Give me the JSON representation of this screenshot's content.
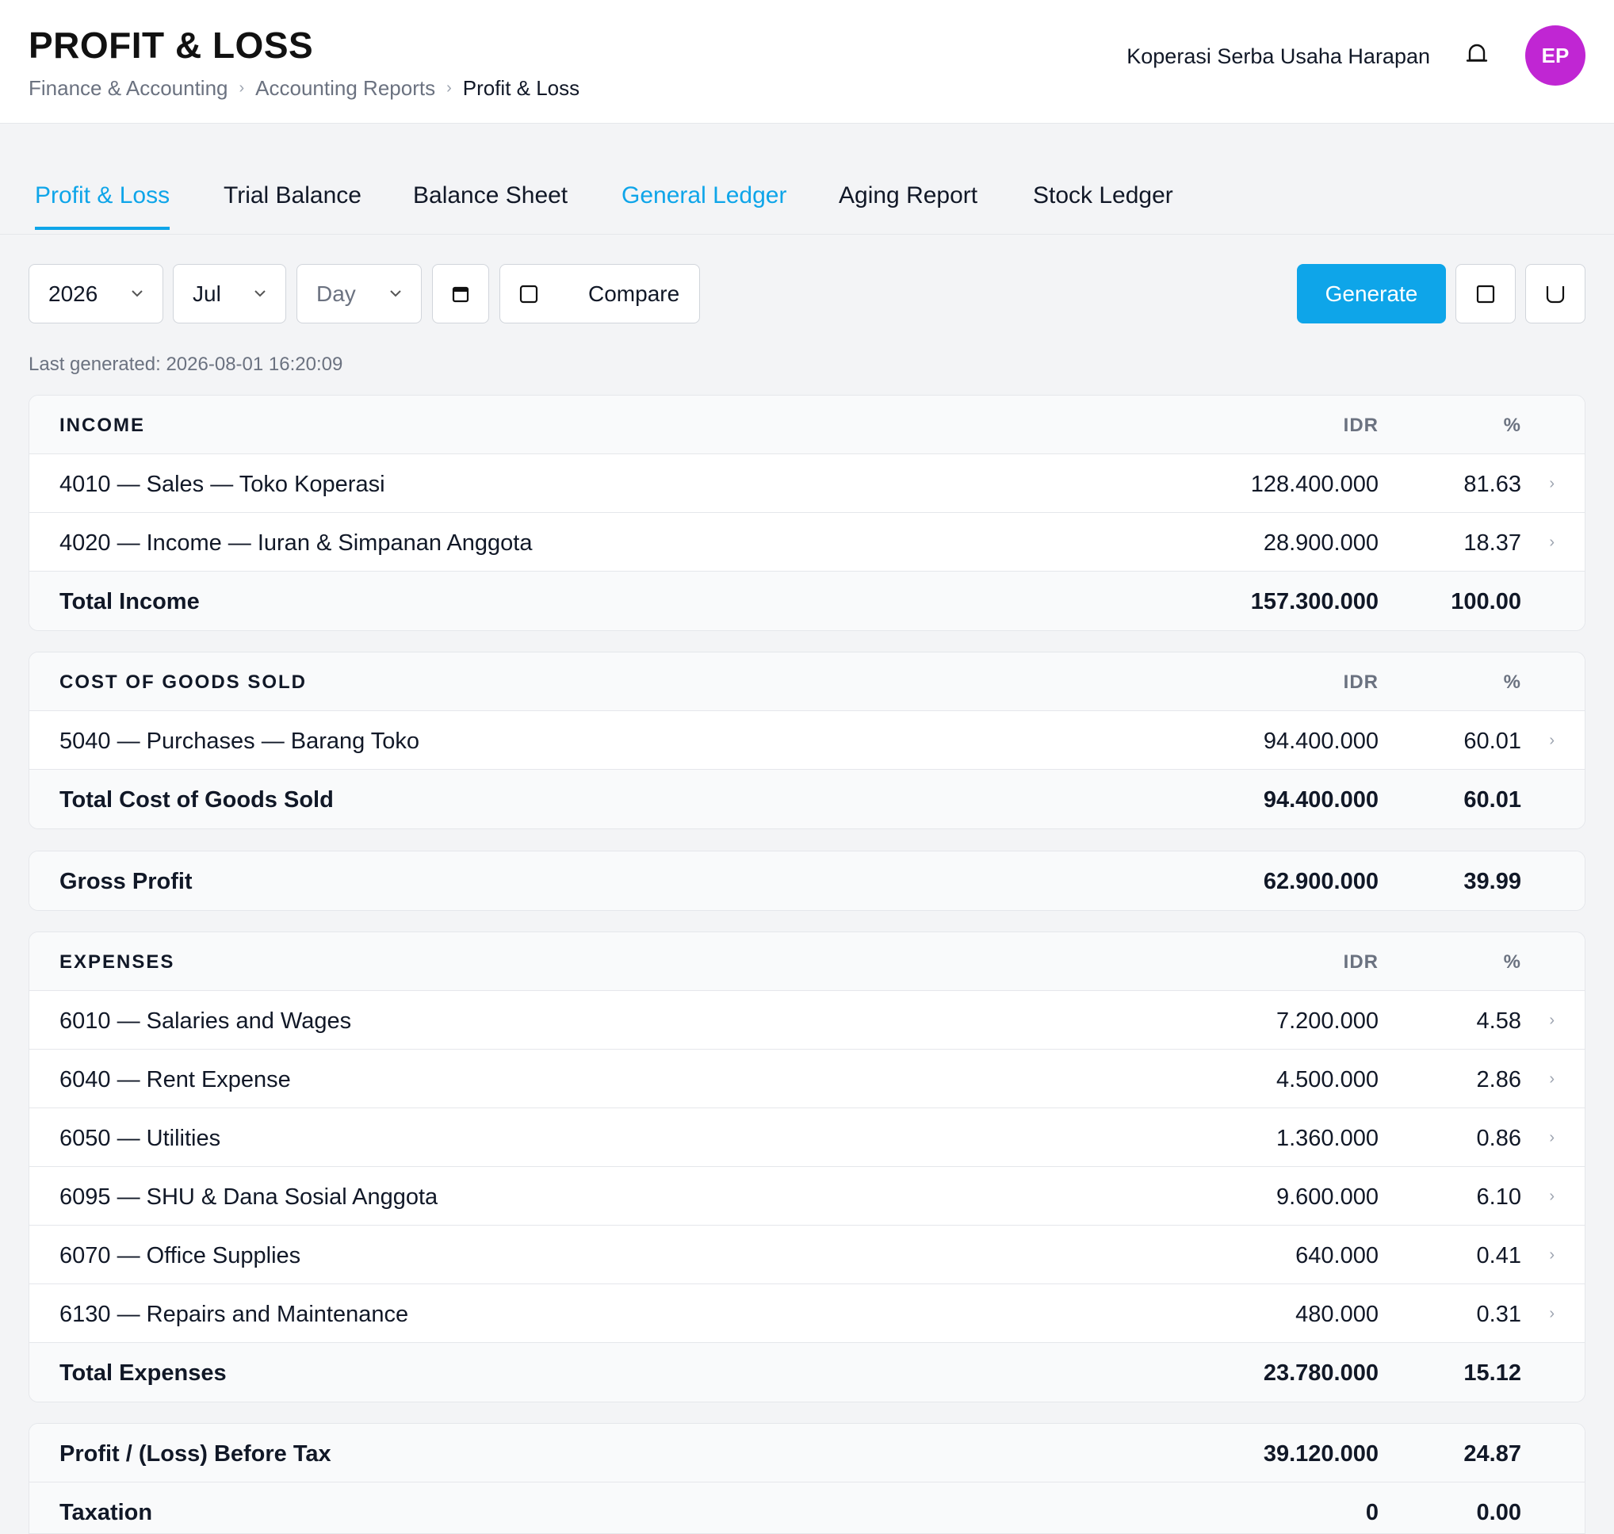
{
  "header": {
    "title": "PROFIT & LOSS",
    "breadcrumb": [
      "Finance & Accounting",
      "Accounting Reports",
      "Profit & Loss"
    ],
    "org_name": "Koperasi Serba Usaha Harapan",
    "avatar_initials": "EP"
  },
  "tabs": [
    {
      "label": "Profit & Loss"
    },
    {
      "label": "Trial Balance"
    },
    {
      "label": "Balance Sheet"
    },
    {
      "label": "General Ledger"
    },
    {
      "label": "Aging Report"
    },
    {
      "label": "Stock Ledger"
    }
  ],
  "toolbar": {
    "year": "2026",
    "month": "Jul",
    "day_placeholder": "Day",
    "compare_label": "Compare",
    "generate_label": "Generate"
  },
  "last_generated": "Last generated: 2026-08-01 16:20:09",
  "columns": {
    "amount": "IDR",
    "percent": "%"
  },
  "income": {
    "heading": "INCOME",
    "rows": [
      {
        "name": "4010 — Sales — Toko Koperasi",
        "amount": "128.400.000",
        "percent": "81.63"
      },
      {
        "name": "4020 — Income — Iuran & Simpanan Anggota",
        "amount": "28.900.000",
        "percent": "18.37"
      }
    ],
    "total": {
      "name": "Total Income",
      "amount": "157.300.000",
      "percent": "100.00"
    }
  },
  "cogs": {
    "heading": "COST OF GOODS SOLD",
    "rows": [
      {
        "name": "5040 — Purchases — Barang Toko",
        "amount": "94.400.000",
        "percent": "60.01"
      }
    ],
    "total": {
      "name": "Total Cost of Goods Sold",
      "amount": "94.400.000",
      "percent": "60.01"
    }
  },
  "gross_profit": {
    "name": "Gross Profit",
    "amount": "62.900.000",
    "percent": "39.99"
  },
  "expenses": {
    "heading": "EXPENSES",
    "rows": [
      {
        "name": "6010 — Salaries and Wages",
        "amount": "7.200.000",
        "percent": "4.58"
      },
      {
        "name": "6040 — Rent Expense",
        "amount": "4.500.000",
        "percent": "2.86"
      },
      {
        "name": "6050 — Utilities",
        "amount": "1.360.000",
        "percent": "0.86"
      },
      {
        "name": "6095 — SHU & Dana Sosial Anggota",
        "amount": "9.600.000",
        "percent": "6.10"
      },
      {
        "name": "6070 — Office Supplies",
        "amount": "640.000",
        "percent": "0.41"
      },
      {
        "name": "6130 — Repairs and Maintenance",
        "amount": "480.000",
        "percent": "0.31"
      }
    ],
    "total": {
      "name": "Total Expenses",
      "amount": "23.780.000",
      "percent": "15.12"
    }
  },
  "before_tax": {
    "name": "Profit / (Loss) Before Tax",
    "amount": "39.120.000",
    "percent": "24.87"
  },
  "taxation": {
    "name": "Taxation",
    "amount": "0",
    "percent": "0.00"
  },
  "colors": {
    "accent": "#0ea5e9",
    "avatar": "#c026d3"
  }
}
